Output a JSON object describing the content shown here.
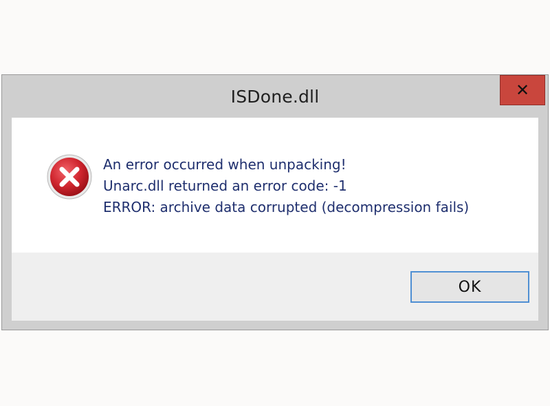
{
  "window": {
    "title": "ISDone.dll",
    "close_label": "✕"
  },
  "icon": "error-icon",
  "messages": [
    "An error occurred when unpacking!",
    "Unarc.dll returned an error code: -1",
    "ERROR: archive data corrupted (decompression fails)"
  ],
  "buttons": {
    "ok_label": "OK"
  },
  "colors": {
    "close_button": "#c9463d",
    "message_text": "#1f2f6e",
    "ok_border": "#4f8fd3",
    "error_icon": "#d0262f"
  }
}
